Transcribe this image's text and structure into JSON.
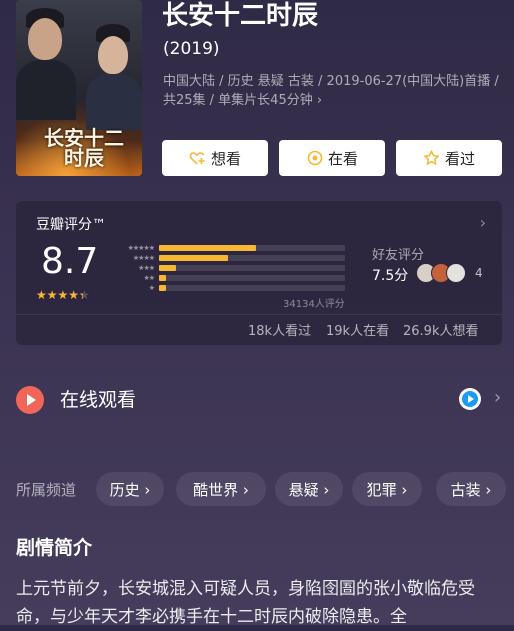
{
  "poster": {
    "title_line1": "长安十二",
    "title_line2": "时辰"
  },
  "header": {
    "title": "长安十二时辰",
    "year": "(2019)",
    "meta": "中国大陆 / 历史 悬疑 古装 / 2019-06-27(中国大陆)首播 / 共25集 / 单集片长45分钟 ›"
  },
  "actions": [
    {
      "label": "想看",
      "icon": "heart-plus-icon"
    },
    {
      "label": "在看",
      "icon": "target-circle-icon"
    },
    {
      "label": "看过",
      "icon": "star-outline-icon"
    }
  ],
  "rating": {
    "label": "豆瓣评分™",
    "score": "8.7",
    "stars": "★★★★★",
    "star_value": 4.35,
    "distribution": [
      {
        "label": "★★★★★",
        "fraction": 0.52
      },
      {
        "label": "★★★★",
        "fraction": 0.37
      },
      {
        "label": "★★★",
        "fraction": 0.09
      },
      {
        "label": "★★",
        "fraction": 0.02
      },
      {
        "label": "★",
        "fraction": 0.01
      }
    ],
    "votes": "34134人评分",
    "friend_label": "好友评分",
    "friend_score": "7.5分",
    "friend_count": "4",
    "watched": "18k人看过",
    "watching": "19k人在看",
    "want": "26.9k人想看"
  },
  "online": {
    "label": "在线观看",
    "provider_icon": "tencent-video-icon"
  },
  "channels": {
    "label": "所属频道",
    "items": [
      "历史 ›",
      "酷世界 ›",
      "悬疑 ›",
      "犯罪 ›",
      "古装 ›"
    ]
  },
  "synopsis": {
    "title": "剧情简介",
    "text": "上元节前夕，长安城混入可疑人员，身陷囹圄的张小敬临危受命，与少年天才李必携手在十二时辰内破除隐患。全"
  },
  "colors": {
    "accent_star": "#f7b733",
    "play_red": "#f0675a",
    "background": "#3b3352"
  }
}
